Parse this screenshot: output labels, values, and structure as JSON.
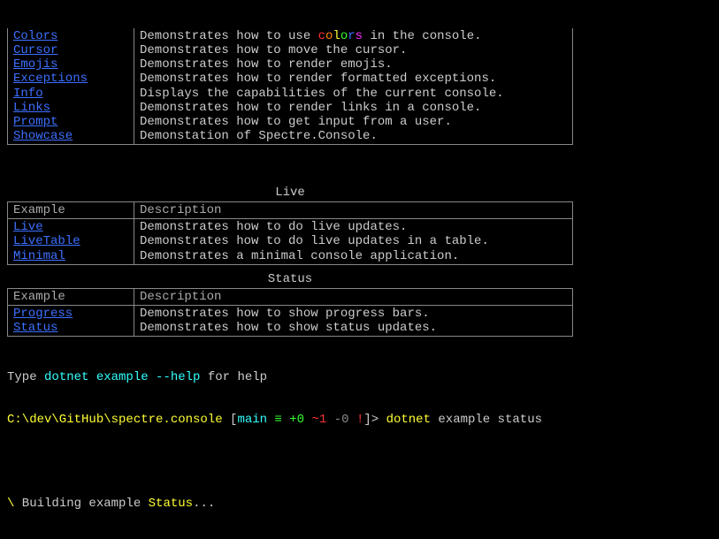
{
  "topRows": [
    {
      "name": "Colors",
      "desc_prefix": "Demonstrates how to use ",
      "colored_word": true,
      "desc_suffix": " in the console."
    },
    {
      "name": "Cursor",
      "desc": "Demonstrates how to move the cursor."
    },
    {
      "name": "Emojis",
      "desc": "Demonstrates how to render emojis."
    },
    {
      "name": "Exceptions",
      "desc": "Demonstrates how to render formatted exceptions."
    },
    {
      "name": "Info",
      "desc": "Displays the capabilities of the current console."
    },
    {
      "name": "Links",
      "desc": "Demonstrates how to render links in a console."
    },
    {
      "name": "Prompt",
      "desc": "Demonstrates how to get input from a user."
    },
    {
      "name": "Showcase",
      "desc": "Demonstation of Spectre.Console."
    }
  ],
  "sections": [
    {
      "title": "Live",
      "headers": {
        "example": "Example",
        "description": "Description"
      },
      "rows": [
        {
          "name": "Live",
          "desc": "Demonstrates how to do live updates."
        },
        {
          "name": "LiveTable",
          "desc": "Demonstrates how to do live updates in a table."
        },
        {
          "name": "Minimal",
          "desc": "Demonstrates a minimal console application."
        }
      ]
    },
    {
      "title": "Status",
      "headers": {
        "example": "Example",
        "description": "Description"
      },
      "rows": [
        {
          "name": "Progress",
          "desc": "Demonstrates how to show progress bars."
        },
        {
          "name": "Status",
          "desc": "Demonstrates how to show status updates."
        }
      ]
    }
  ],
  "help": {
    "prefix": "Type ",
    "command": "dotnet example --help",
    "suffix": " for help"
  },
  "prompt": {
    "path": "C:\\dev\\GitHub\\spectre.console",
    "branch": "main",
    "eq": "≡",
    "plus": "+0",
    "tilde": "~1",
    "minus": "-0",
    "bang": "!",
    "arrow": ">",
    "command": "dotnet",
    "args": "example status"
  },
  "status": {
    "spinner": "\\",
    "prefix": " Building example ",
    "name": "Status",
    "suffix": "..."
  }
}
